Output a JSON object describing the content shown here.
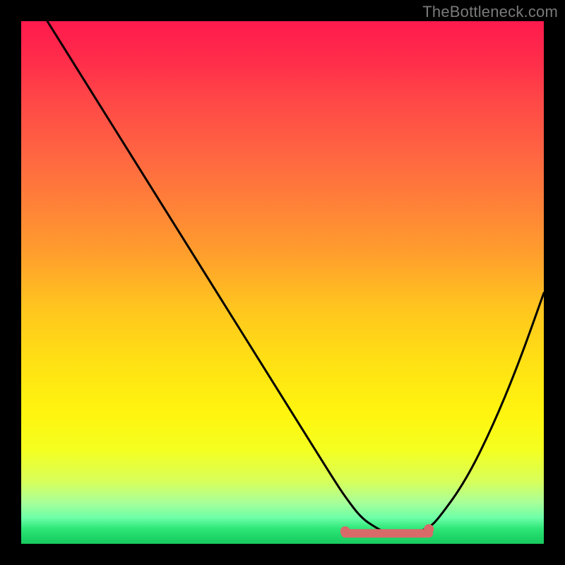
{
  "watermark": "TheBottleneck.com",
  "chart_data": {
    "type": "line",
    "title": "",
    "xlabel": "",
    "ylabel": "",
    "xlim": [
      0,
      100
    ],
    "ylim": [
      0,
      100
    ],
    "x": [
      5,
      10,
      15,
      20,
      25,
      30,
      35,
      40,
      45,
      50,
      55,
      60,
      62,
      65,
      68,
      70,
      72,
      75,
      78,
      80,
      85,
      90,
      95,
      100
    ],
    "values": [
      100,
      92,
      84,
      76,
      68,
      60,
      52,
      44,
      36,
      28,
      20,
      12,
      9,
      5,
      3,
      2,
      2,
      2,
      3,
      5,
      12,
      22,
      34,
      48
    ],
    "trough_region_x": [
      62,
      78
    ],
    "trough_region_y": 2,
    "colors": {
      "curve": "#000000",
      "markers": "#d86a6a",
      "gradient_top": "#ff1a4d",
      "gradient_bottom": "#18c95e"
    }
  }
}
